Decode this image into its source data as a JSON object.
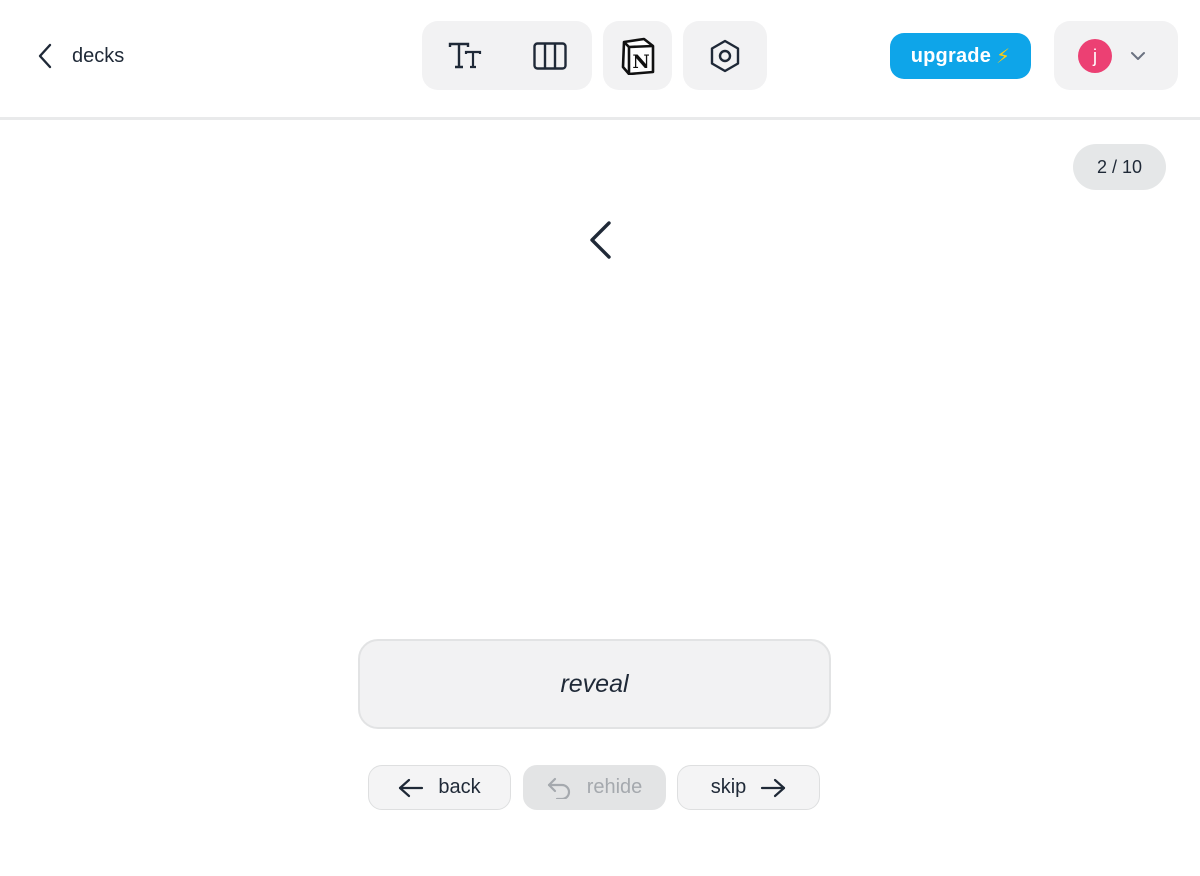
{
  "header": {
    "back_label": "decks",
    "tools": [
      {
        "name": "text-size-icon"
      },
      {
        "name": "columns-icon"
      },
      {
        "name": "notion-icon"
      },
      {
        "name": "settings-hex-icon"
      }
    ],
    "notion_letter": "N",
    "upgrade_label": "upgrade",
    "upgrade_icon": "⚡",
    "account": {
      "initial": "j",
      "avatar_color": "#ec4073"
    }
  },
  "study": {
    "counter": "2 / 10",
    "card_front_icon": "chevron-left-icon",
    "reveal_label": "reveal",
    "back_label": "back",
    "rehide_label": "rehide",
    "skip_label": "skip"
  },
  "colors": {
    "accent": "#0ea5e9",
    "bolt": "#facc15",
    "panel": "#f2f2f3",
    "text": "#1f2937",
    "disabled_text": "#a5a9ae"
  }
}
